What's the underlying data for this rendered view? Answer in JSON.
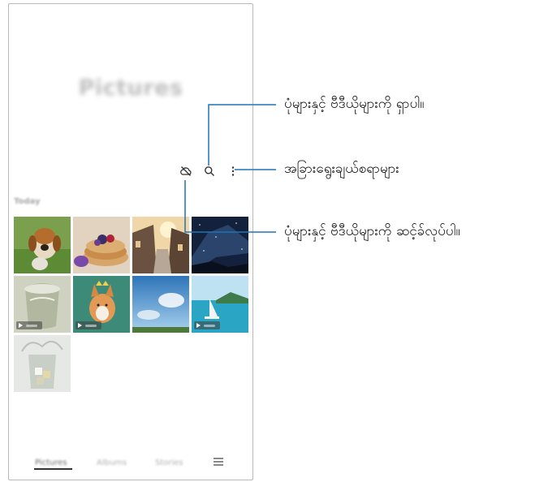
{
  "app": {
    "title": "Pictures",
    "section_label": "Today",
    "colors": {
      "callout_line": "#1d75b8",
      "accent_underline": "#333333"
    }
  },
  "toolbar": {
    "icons": [
      "cloud-sync-off-icon",
      "search-icon",
      "more-options-icon"
    ]
  },
  "thumbnails": [
    {
      "subject": "beagle dog",
      "video": false
    },
    {
      "subject": "pancakes with berries",
      "video": false
    },
    {
      "subject": "village street at sunset",
      "video": false
    },
    {
      "subject": "starry night sky",
      "video": false
    },
    {
      "subject": "glass of water splash",
      "video": true
    },
    {
      "subject": "corgi with crown",
      "video": true
    },
    {
      "subject": "blue sky with clouds",
      "video": false
    },
    {
      "subject": "sailboat at sea",
      "video": true
    },
    {
      "subject": "ice in glass splash",
      "video": false
    }
  ],
  "bottom_tabs": [
    "Pictures",
    "Albums",
    "Stories"
  ],
  "callouts": {
    "search": "ပုံများနှင့် ဗီဒီယိုများကို ရှာပါ။",
    "more_options": "အခြားရွေးချယ်စရာများ",
    "sync": "ပုံများနှင့် ဗီဒီယိုများကို ဆင့်ခ်လုပ်ပါ။"
  }
}
